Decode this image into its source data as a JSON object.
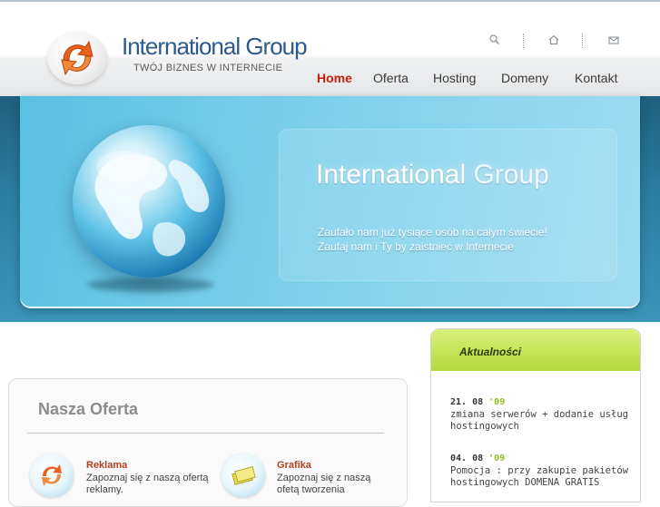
{
  "brand": {
    "name": "International Group",
    "tagline": "TWÓJ BIZNES W INTERNECIE"
  },
  "utility_icons": [
    "search-icon",
    "home-icon",
    "mail-icon"
  ],
  "nav": [
    {
      "label": "Home",
      "active": true
    },
    {
      "label": "Oferta",
      "active": false
    },
    {
      "label": "Hosting",
      "active": false
    },
    {
      "label": "Domeny",
      "active": false
    },
    {
      "label": "Kontakt",
      "active": false
    }
  ],
  "hero": {
    "title_main": "International",
    "title_accent": "Group",
    "line1": "Zaufało nam już tysiące osób na całym świecie!",
    "line2": "Zaufaj nam i Ty by zaistnieć w Internecie"
  },
  "offer": {
    "title": "Nasza Oferta",
    "items": [
      {
        "name": "Reklama",
        "line1": "Zapoznaj się z naszą ofertą",
        "line2": "reklamy."
      },
      {
        "name": "Grafika",
        "line1": "Zapoznaj się z naszą",
        "line2": "ofetą tworzenia"
      }
    ]
  },
  "news": {
    "title": "Aktualności",
    "items": [
      {
        "date": "21. 08",
        "year": "'09",
        "line1": "zmiana serwerów + dodanie usług",
        "line2": "hostingowych"
      },
      {
        "date": "04. 08",
        "year": "'09",
        "line1": "Pomocja : przy zakupie pakietów",
        "line2": "hostingowych DOMENA GRATIS"
      }
    ]
  },
  "colors": {
    "brand_blue": "#2c5a8c",
    "nav_active": "#c8200e",
    "hero_blue": "#5bc0e2",
    "news_green": "#b4d93a",
    "offer_title": "#b3401c"
  }
}
